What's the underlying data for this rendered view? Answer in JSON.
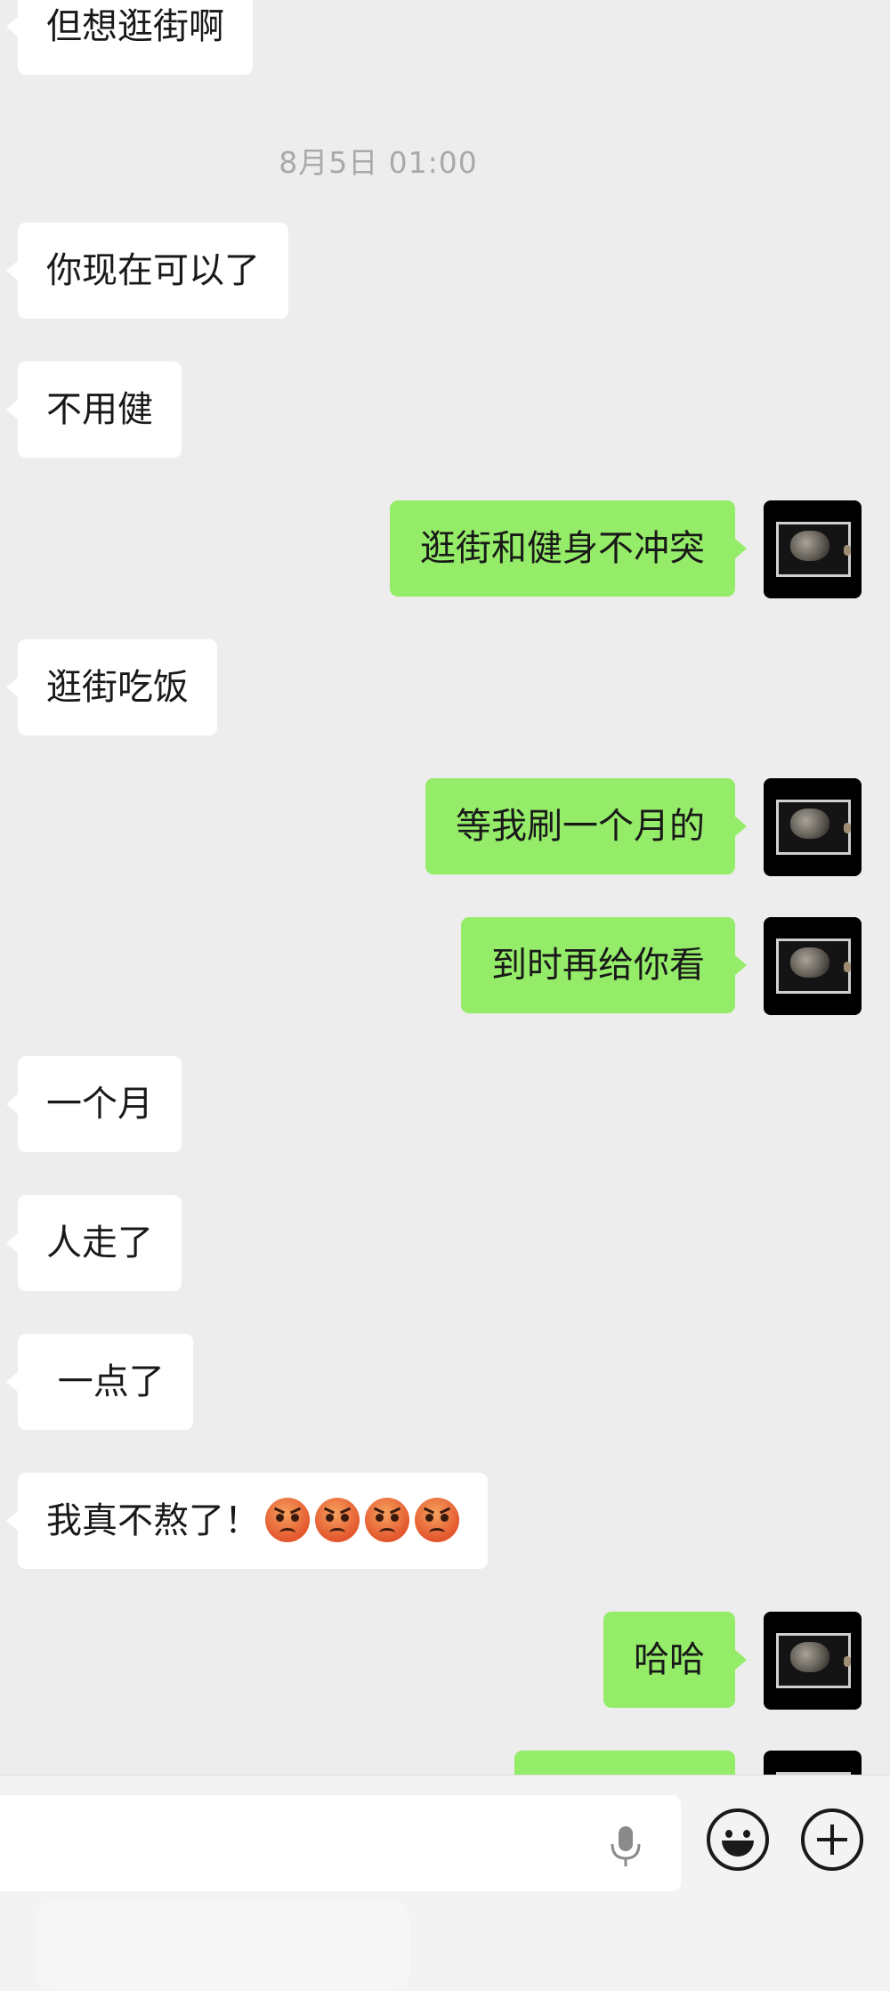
{
  "chat": {
    "messages": [
      {
        "side": "in",
        "text": "但想逛街啊"
      },
      {
        "type": "timestamp",
        "text": "8月5日 01:00"
      },
      {
        "side": "in",
        "text": "你现在可以了"
      },
      {
        "side": "in",
        "text": "不用健"
      },
      {
        "side": "out",
        "text": "逛街和健身不冲突"
      },
      {
        "side": "in",
        "text": "逛街吃饭"
      },
      {
        "side": "out",
        "text": "等我刷一个月的"
      },
      {
        "side": "out",
        "text": "到时再给你看"
      },
      {
        "side": "in",
        "text": "一个月"
      },
      {
        "side": "in",
        "text": "人走了"
      },
      {
        "side": "in",
        "text": " 一点了"
      },
      {
        "side": "in",
        "text": "我真不熬了！",
        "emojis": 4,
        "emoji_icon": "angry-face-icon"
      },
      {
        "side": "out",
        "text": "哈哈"
      },
      {
        "side": "out",
        "text": ""
      }
    ],
    "colors": {
      "incoming_bubble": "#ffffff",
      "outgoing_bubble": "#95ec69",
      "background": "#ededed",
      "timestamp": "#a9a9a9"
    },
    "avatar_icon": "avatar-image"
  },
  "input_bar": {
    "mic_icon": "microphone-icon",
    "emoji_icon": "emoji-smiley-icon",
    "plus_icon": "plus-circle-icon"
  }
}
